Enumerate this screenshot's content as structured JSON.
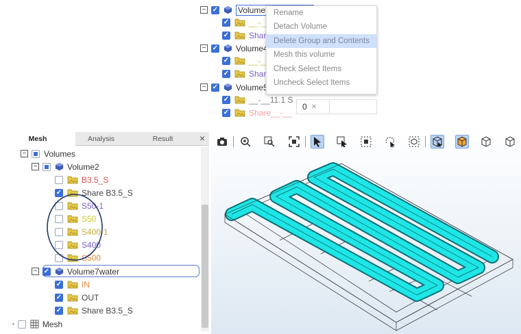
{
  "top_tree": {
    "volume3": "Volume3",
    "v3_child1": "__-__1",
    "v3_child2": "Share",
    "volume4": "Volume4",
    "v4_child1": "__-__1",
    "v4_child2": "Share",
    "volume5": "Volume5",
    "v5_child1": "__-__11.1 S",
    "v5_child2": "Share__-__"
  },
  "context_menu": {
    "items": [
      "Rename",
      "Detach Volume",
      "Delete Group and Contents",
      "Mesh this volume",
      "Check Select Items",
      "Uncheck Select Items"
    ],
    "highlighted": "Delete Group and Contents"
  },
  "badge": {
    "count": "0",
    "close": "✕"
  },
  "panel": {
    "tabs": [
      "Mesh",
      "Analysis",
      "Result"
    ],
    "active_tab": "Mesh",
    "close": "✕"
  },
  "tree": {
    "volumes": "Volumes",
    "volume2": "Volume2",
    "v2_items": [
      "B3.5_S",
      "Share B3.5_S",
      "S50-1",
      "S50",
      "S400-1",
      "S400",
      "S500"
    ],
    "volume7": "Volume7water",
    "v7_items": [
      "IN",
      "OUT",
      "Share B3.5_S"
    ],
    "mesh": "Mesh"
  },
  "colors": {
    "accent": "#3b6fd8",
    "cyan": "#1ee6e6",
    "annotation_circle": "#1e3a6b",
    "label_red": "#d9534f",
    "label_purple": "#7b5fc9",
    "label_yellow": "#c8c838",
    "label_orange": "#e0883a"
  },
  "toolbar": {
    "icons": [
      "camera-icon",
      "zoom-icon",
      "zoom-box-icon",
      "fit-icon",
      "select-arrow-icon",
      "select-box-icon",
      "select-face-icon",
      "lasso-icon",
      "select-volume-icon",
      "view-wire-cube-icon",
      "view-solid-cube-icon",
      "view-front-cube-icon",
      "view-iso-cube-icon"
    ]
  }
}
